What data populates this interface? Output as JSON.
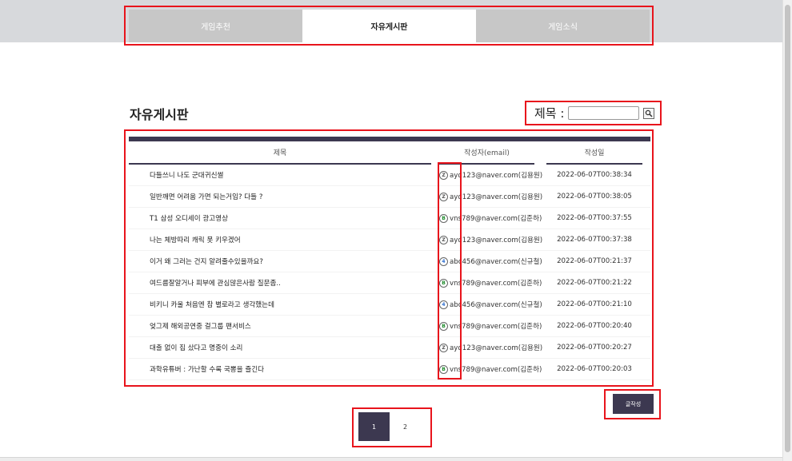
{
  "tabs": [
    {
      "label": "게임추천",
      "active": false
    },
    {
      "label": "자유게시판",
      "active": true
    },
    {
      "label": "게임소식",
      "active": false
    }
  ],
  "page_title": "자유게시판",
  "search": {
    "label": "제목 :",
    "value": "",
    "button_icon": "search-icon"
  },
  "table": {
    "headers": {
      "title": "제목",
      "author": "작성자(email)",
      "date": "작성일"
    },
    "rows": [
      {
        "title": "다들쓰니 나도 군대귀신썰",
        "avatar": "gray",
        "avatar_text": "Z",
        "author": "ayd123@naver.com(김용원)",
        "date": "2022-06-07T00:38:34"
      },
      {
        "title": "일반깨면 어려움 가면 되는거임? 다들 ?",
        "avatar": "gray",
        "avatar_text": "Z",
        "author": "ayd123@naver.com(김용원)",
        "date": "2022-06-07T00:38:05"
      },
      {
        "title": "T1 삼성 오디세이 광고영상",
        "avatar": "green",
        "avatar_text": "B",
        "author": "vns789@naver.com(김준하)",
        "date": "2022-06-07T00:37:55"
      },
      {
        "title": "나는 체방따리 캐릭 못 키우겠어",
        "avatar": "gray",
        "avatar_text": "Z",
        "author": "ayd123@naver.com(김용원)",
        "date": "2022-06-07T00:37:38"
      },
      {
        "title": "이거 왜 그러는 건지 알려줄수있을까요?",
        "avatar": "blue",
        "avatar_text": "4",
        "author": "abc456@naver.com(신규철)",
        "date": "2022-06-07T00:21:37"
      },
      {
        "title": "여드름잘알거나 피부에 관심많은사람 질문좀..",
        "avatar": "green",
        "avatar_text": "B",
        "author": "vns789@naver.com(김준하)",
        "date": "2022-06-07T00:21:22"
      },
      {
        "title": "비키니 카울 처음엔 참 별로라고 생각했는데",
        "avatar": "blue",
        "avatar_text": "4",
        "author": "abc456@naver.com(신규철)",
        "date": "2022-06-07T00:21:10"
      },
      {
        "title": "엊그제 해외공연중 걸그룹 팬서비스",
        "avatar": "green",
        "avatar_text": "B",
        "author": "vns789@naver.com(김준하)",
        "date": "2022-06-07T00:20:40"
      },
      {
        "title": "대출 없이 집 샀다고 명중이 소리",
        "avatar": "gray",
        "avatar_text": "Z",
        "author": "ayd123@naver.com(김용원)",
        "date": "2022-06-07T00:20:27"
      },
      {
        "title": "과학유튜버 : 가난할 수록 국뽕을 즐긴다",
        "avatar": "green",
        "avatar_text": "B",
        "author": "vns789@naver.com(김준하)",
        "date": "2022-06-07T00:20:03"
      }
    ]
  },
  "write_button": "글작성",
  "pagination": [
    {
      "label": "1",
      "active": true
    },
    {
      "label": "2",
      "active": false
    }
  ]
}
